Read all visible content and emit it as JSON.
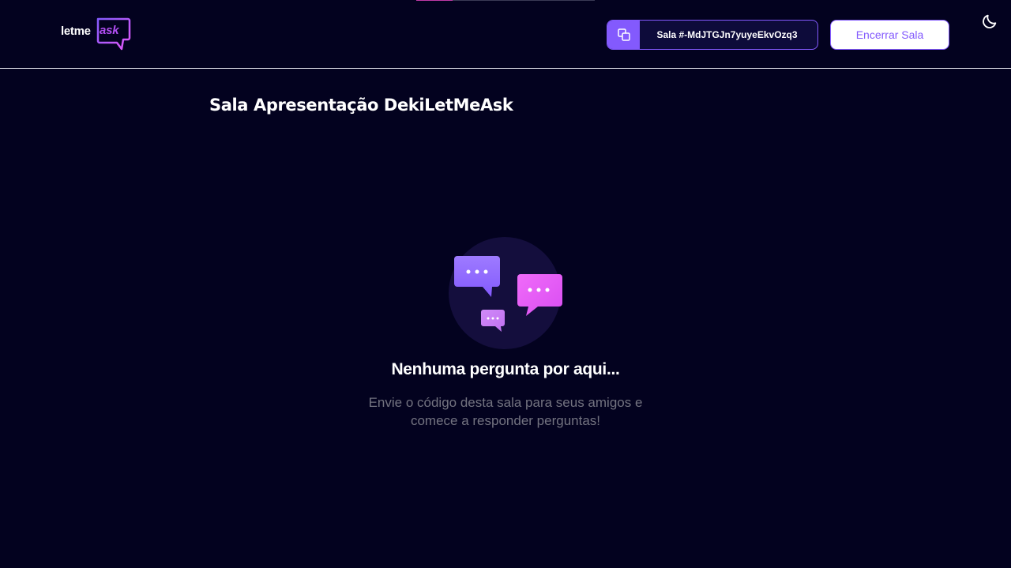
{
  "header": {
    "logo": {
      "text_left": "letme",
      "text_right": "ask"
    },
    "room_code": {
      "label": "Sala #-MdJTGJn7yuyeEkvOzq3",
      "icon": "copy-icon"
    },
    "end_room_label": "Encerrar Sala",
    "theme_toggle_icon": "moon-icon"
  },
  "main": {
    "room_title": "Sala Apresentação DekiLetMeAsk",
    "empty_state": {
      "icon": "chat-bubbles-icon",
      "title": "Nenhuma pergunta por aqui...",
      "description": "Envie o código desta sala para seus amigos e comece a responder perguntas!"
    }
  },
  "colors": {
    "background": "#03021f",
    "accent": "#835afd",
    "pink": "#e559f9",
    "muted_text": "#737380"
  }
}
